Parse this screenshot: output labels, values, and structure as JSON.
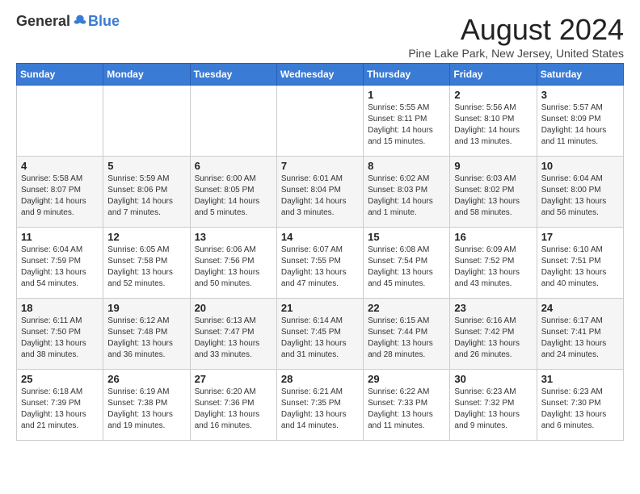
{
  "header": {
    "logo_general": "General",
    "logo_blue": "Blue",
    "month_title": "August 2024",
    "location": "Pine Lake Park, New Jersey, United States"
  },
  "days_of_week": [
    "Sunday",
    "Monday",
    "Tuesday",
    "Wednesday",
    "Thursday",
    "Friday",
    "Saturday"
  ],
  "weeks": [
    [
      {
        "day": "",
        "info": ""
      },
      {
        "day": "",
        "info": ""
      },
      {
        "day": "",
        "info": ""
      },
      {
        "day": "",
        "info": ""
      },
      {
        "day": "1",
        "info": "Sunrise: 5:55 AM\nSunset: 8:11 PM\nDaylight: 14 hours\nand 15 minutes."
      },
      {
        "day": "2",
        "info": "Sunrise: 5:56 AM\nSunset: 8:10 PM\nDaylight: 14 hours\nand 13 minutes."
      },
      {
        "day": "3",
        "info": "Sunrise: 5:57 AM\nSunset: 8:09 PM\nDaylight: 14 hours\nand 11 minutes."
      }
    ],
    [
      {
        "day": "4",
        "info": "Sunrise: 5:58 AM\nSunset: 8:07 PM\nDaylight: 14 hours\nand 9 minutes."
      },
      {
        "day": "5",
        "info": "Sunrise: 5:59 AM\nSunset: 8:06 PM\nDaylight: 14 hours\nand 7 minutes."
      },
      {
        "day": "6",
        "info": "Sunrise: 6:00 AM\nSunset: 8:05 PM\nDaylight: 14 hours\nand 5 minutes."
      },
      {
        "day": "7",
        "info": "Sunrise: 6:01 AM\nSunset: 8:04 PM\nDaylight: 14 hours\nand 3 minutes."
      },
      {
        "day": "8",
        "info": "Sunrise: 6:02 AM\nSunset: 8:03 PM\nDaylight: 14 hours\nand 1 minute."
      },
      {
        "day": "9",
        "info": "Sunrise: 6:03 AM\nSunset: 8:02 PM\nDaylight: 13 hours\nand 58 minutes."
      },
      {
        "day": "10",
        "info": "Sunrise: 6:04 AM\nSunset: 8:00 PM\nDaylight: 13 hours\nand 56 minutes."
      }
    ],
    [
      {
        "day": "11",
        "info": "Sunrise: 6:04 AM\nSunset: 7:59 PM\nDaylight: 13 hours\nand 54 minutes."
      },
      {
        "day": "12",
        "info": "Sunrise: 6:05 AM\nSunset: 7:58 PM\nDaylight: 13 hours\nand 52 minutes."
      },
      {
        "day": "13",
        "info": "Sunrise: 6:06 AM\nSunset: 7:56 PM\nDaylight: 13 hours\nand 50 minutes."
      },
      {
        "day": "14",
        "info": "Sunrise: 6:07 AM\nSunset: 7:55 PM\nDaylight: 13 hours\nand 47 minutes."
      },
      {
        "day": "15",
        "info": "Sunrise: 6:08 AM\nSunset: 7:54 PM\nDaylight: 13 hours\nand 45 minutes."
      },
      {
        "day": "16",
        "info": "Sunrise: 6:09 AM\nSunset: 7:52 PM\nDaylight: 13 hours\nand 43 minutes."
      },
      {
        "day": "17",
        "info": "Sunrise: 6:10 AM\nSunset: 7:51 PM\nDaylight: 13 hours\nand 40 minutes."
      }
    ],
    [
      {
        "day": "18",
        "info": "Sunrise: 6:11 AM\nSunset: 7:50 PM\nDaylight: 13 hours\nand 38 minutes."
      },
      {
        "day": "19",
        "info": "Sunrise: 6:12 AM\nSunset: 7:48 PM\nDaylight: 13 hours\nand 36 minutes."
      },
      {
        "day": "20",
        "info": "Sunrise: 6:13 AM\nSunset: 7:47 PM\nDaylight: 13 hours\nand 33 minutes."
      },
      {
        "day": "21",
        "info": "Sunrise: 6:14 AM\nSunset: 7:45 PM\nDaylight: 13 hours\nand 31 minutes."
      },
      {
        "day": "22",
        "info": "Sunrise: 6:15 AM\nSunset: 7:44 PM\nDaylight: 13 hours\nand 28 minutes."
      },
      {
        "day": "23",
        "info": "Sunrise: 6:16 AM\nSunset: 7:42 PM\nDaylight: 13 hours\nand 26 minutes."
      },
      {
        "day": "24",
        "info": "Sunrise: 6:17 AM\nSunset: 7:41 PM\nDaylight: 13 hours\nand 24 minutes."
      }
    ],
    [
      {
        "day": "25",
        "info": "Sunrise: 6:18 AM\nSunset: 7:39 PM\nDaylight: 13 hours\nand 21 minutes."
      },
      {
        "day": "26",
        "info": "Sunrise: 6:19 AM\nSunset: 7:38 PM\nDaylight: 13 hours\nand 19 minutes."
      },
      {
        "day": "27",
        "info": "Sunrise: 6:20 AM\nSunset: 7:36 PM\nDaylight: 13 hours\nand 16 minutes."
      },
      {
        "day": "28",
        "info": "Sunrise: 6:21 AM\nSunset: 7:35 PM\nDaylight: 13 hours\nand 14 minutes."
      },
      {
        "day": "29",
        "info": "Sunrise: 6:22 AM\nSunset: 7:33 PM\nDaylight: 13 hours\nand 11 minutes."
      },
      {
        "day": "30",
        "info": "Sunrise: 6:23 AM\nSunset: 7:32 PM\nDaylight: 13 hours\nand 9 minutes."
      },
      {
        "day": "31",
        "info": "Sunrise: 6:23 AM\nSunset: 7:30 PM\nDaylight: 13 hours\nand 6 minutes."
      }
    ]
  ]
}
